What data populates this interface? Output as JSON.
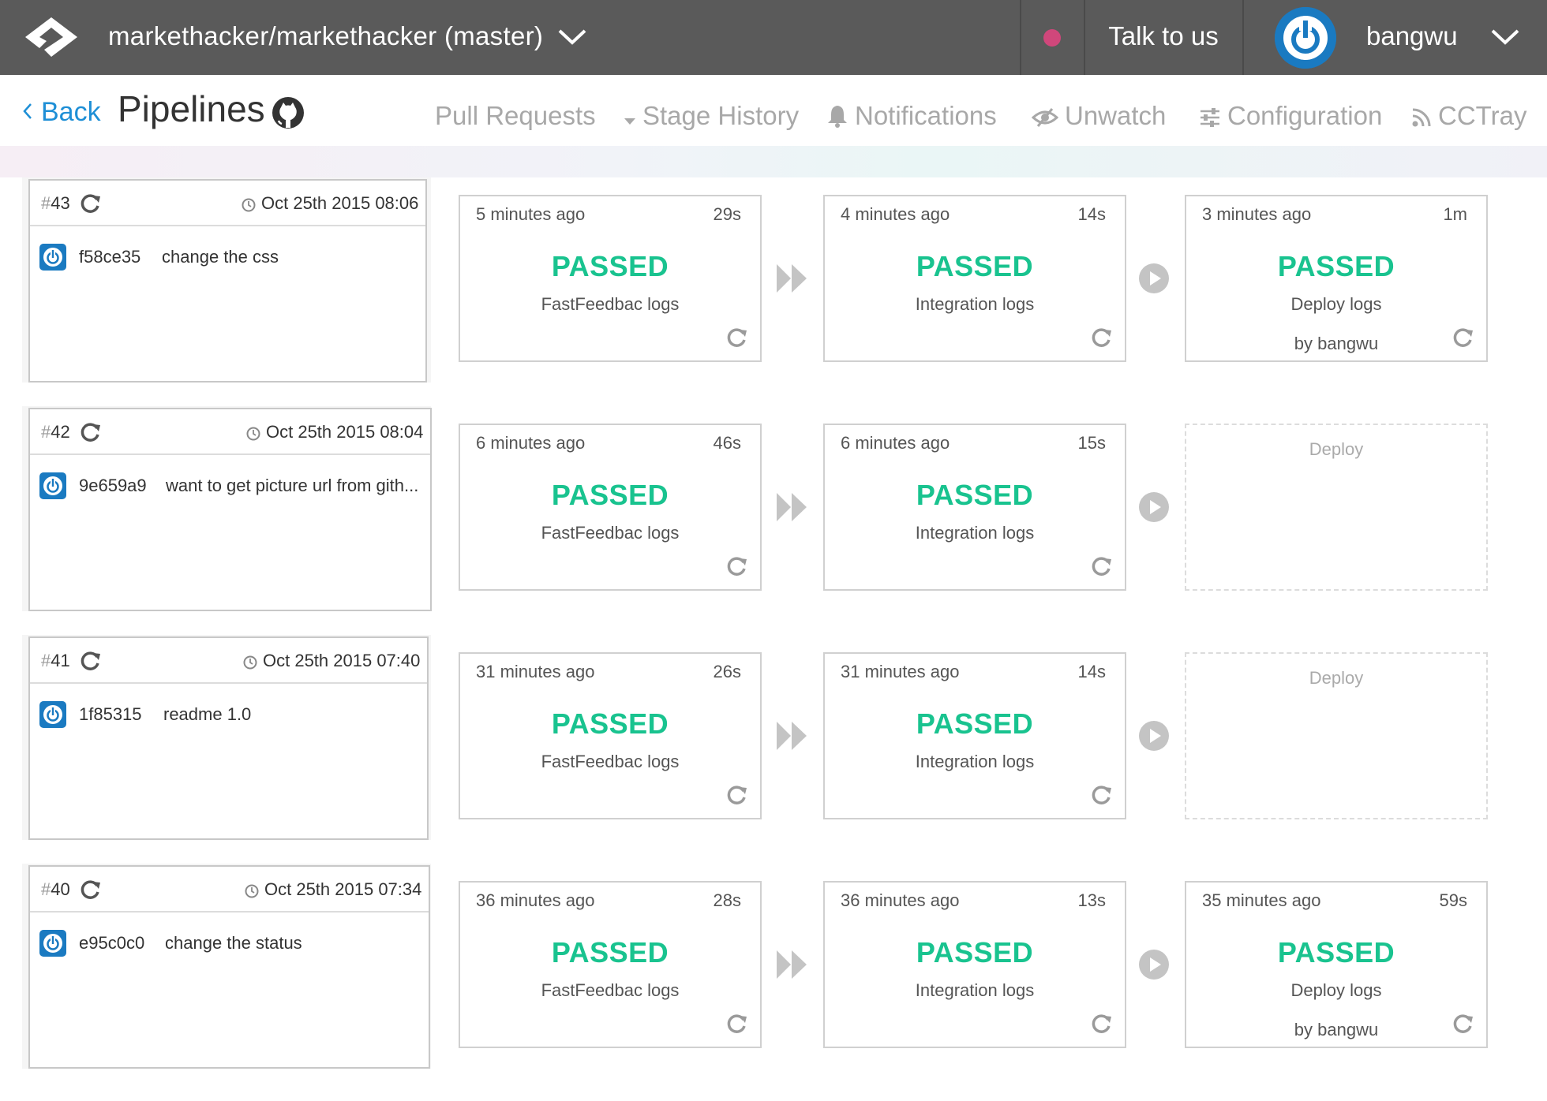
{
  "header": {
    "repo_title": "markethacker/markethacker (master)",
    "talk_label": "Talk to us",
    "username": "bangwu",
    "status_color": "#d0477b",
    "brand_color": "#1a7ac1"
  },
  "subheader": {
    "back_label": "Back",
    "page_title": "Pipelines",
    "nav": {
      "pull_requests": "Pull Requests",
      "stage_history": "Stage History",
      "notifications": "Notifications",
      "unwatch": "Unwatch",
      "configuration": "Configuration",
      "cctray": "CCTray"
    }
  },
  "pipelines": [
    {
      "number": "43",
      "date": "Oct 25th 2015 08:06",
      "commit_hash": "f58ce35",
      "commit_message": "change the css",
      "stages": [
        {
          "time": "5 minutes ago",
          "duration": "29s",
          "status": "PASSED",
          "label": "FastFeedbac logs",
          "by": ""
        },
        {
          "time": "4 minutes ago",
          "duration": "14s",
          "status": "PASSED",
          "label": "Integration logs",
          "by": ""
        },
        {
          "time": "3 minutes ago",
          "duration": "1m",
          "status": "PASSED",
          "label": "Deploy logs",
          "by": "by bangwu"
        }
      ]
    },
    {
      "number": "42",
      "date": "Oct 25th 2015 08:04",
      "commit_hash": "9e659a9",
      "commit_message": "want to get picture url from gith...",
      "stages": [
        {
          "time": "6 minutes ago",
          "duration": "46s",
          "status": "PASSED",
          "label": "FastFeedbac logs",
          "by": ""
        },
        {
          "time": "6 minutes ago",
          "duration": "15s",
          "status": "PASSED",
          "label": "Integration logs",
          "by": ""
        },
        {
          "pending_name": "Deploy"
        }
      ]
    },
    {
      "number": "41",
      "date": "Oct 25th 2015 07:40",
      "commit_hash": "1f85315",
      "commit_message": "readme 1.0",
      "stages": [
        {
          "time": "31 minutes ago",
          "duration": "26s",
          "status": "PASSED",
          "label": "FastFeedbac logs",
          "by": ""
        },
        {
          "time": "31 minutes ago",
          "duration": "14s",
          "status": "PASSED",
          "label": "Integration logs",
          "by": ""
        },
        {
          "pending_name": "Deploy"
        }
      ]
    },
    {
      "number": "40",
      "date": "Oct 25th 2015 07:34",
      "commit_hash": "e95c0c0",
      "commit_message": "change the status",
      "stages": [
        {
          "time": "36 minutes ago",
          "duration": "28s",
          "status": "PASSED",
          "label": "FastFeedbac logs",
          "by": ""
        },
        {
          "time": "36 minutes ago",
          "duration": "13s",
          "status": "PASSED",
          "label": "Integration logs",
          "by": ""
        },
        {
          "time": "35 minutes ago",
          "duration": "59s",
          "status": "PASSED",
          "label": "Deploy logs",
          "by": "by bangwu"
        }
      ]
    }
  ]
}
